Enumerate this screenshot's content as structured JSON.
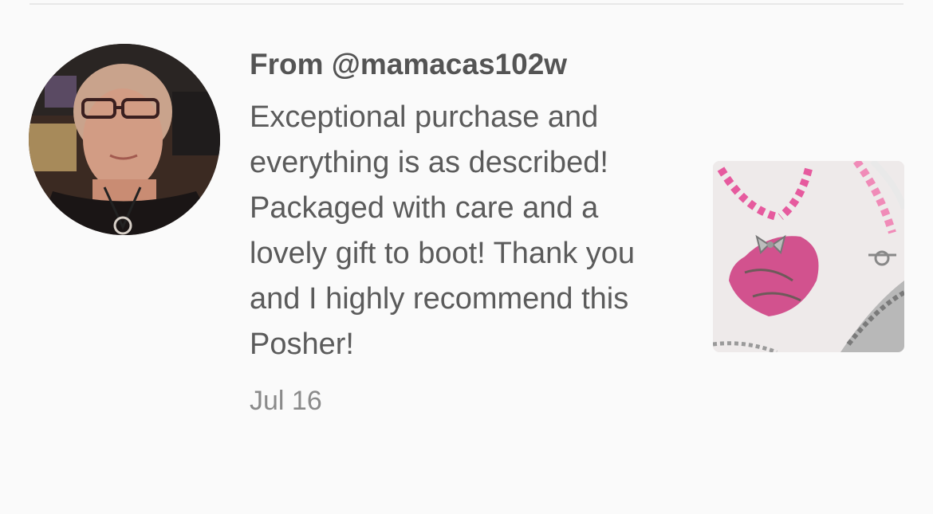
{
  "review": {
    "from_label": "From @mamacas102w",
    "body": "Exceptional purchase and everything is as described! Packaged with care and a lovely gift to boot! Thank you and I highly recommend this Posher!",
    "date": "Jul 16"
  },
  "icons": {
    "avatar": "user-avatar-photo",
    "thumbnail": "pink-pendant-necklace-photo"
  },
  "colors": {
    "background": "#fafafa",
    "text": "#5b5b5b",
    "date": "#8a8a8a",
    "pendant_pink": "#d2528e"
  }
}
